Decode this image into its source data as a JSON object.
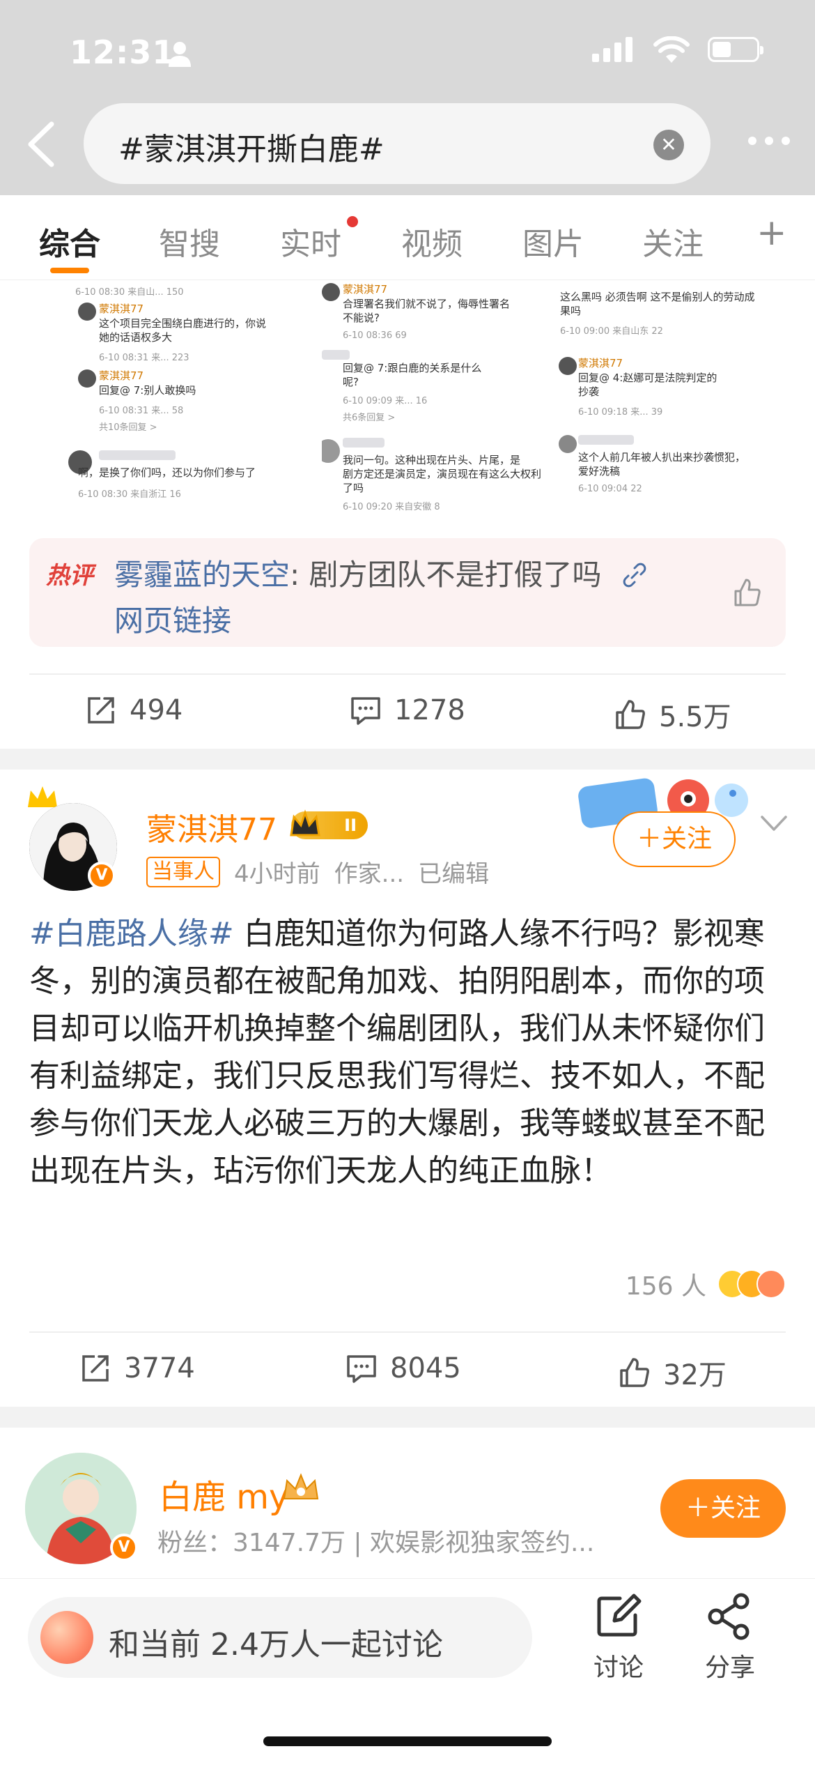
{
  "status_bar": {
    "time": "12:31"
  },
  "search": {
    "query": "#蒙淇淇开撕白鹿#"
  },
  "tabs": [
    {
      "label": "综合"
    },
    {
      "label": "智搜"
    },
    {
      "label": "实时"
    },
    {
      "label": "视频"
    },
    {
      "label": "图片"
    },
    {
      "label": "关注"
    }
  ],
  "tabs_plus": "+",
  "screenshots": {
    "col1": [
      "6-10 08:30  来自山...        150",
      "蒙淇淇77",
      "这个项目完全围绕白鹿进行的，你说",
      "她的话语权多大",
      "6-10 08:31  来...              223",
      "蒙淇淇77",
      "回复@       7:别人敢换吗",
      "6-10 08:31  来...               58",
      "共10条回复 >",
      "啊，是换了你们吗，还以为你们参与了",
      "6-10 08:30  来自浙江            16"
    ],
    "col2": [
      "蒙淇淇77",
      "合理署名我们就不说了，侮辱性署名",
      "不能说?",
      "6-10 08:36                        69",
      "回复@         7:跟白鹿的关系是什么",
      "呢?",
      "6-10 09:09  来...              16",
      "共6条回复 >",
      "我问一句。这种出现在片头、片尾，是",
      "剧方定还是演员定，演员现在有这么大权利",
      "了吗",
      "6-10 09:20  来自安徽             8"
    ],
    "col3": [
      "这么黑吗 必须告啊 这不是偷别人的劳动成",
      "果吗",
      "6-10 09:00  来自山东            22",
      "蒙淇淇77",
      "回复@        4:赵娜可是法院判定的",
      "抄袭",
      "6-10 09:18  来...              39",
      "这个人前几年被人扒出来抄袭惯犯，",
      "爱好洗稿",
      "6-10 09:04                        22"
    ]
  },
  "hot_comment": {
    "badge": "热评",
    "user": "雾霾蓝的天空",
    "text": ": 剧方团队不是打假了吗",
    "link_label": "网页链接"
  },
  "post1_actions": {
    "shares": "494",
    "comments": "1278",
    "likes": "5.5万"
  },
  "post2": {
    "username": "蒙淇淇77",
    "level": "II",
    "role_tag": "当事人",
    "time": "4小时前",
    "source": "作家...",
    "edited": "已编辑",
    "follow_label": "＋关注",
    "hashtag": "#白鹿路人缘#",
    "body": " 白鹿知道你为何路人缘不行吗？影视寒冬，别的演员都在被配角加戏、拍阴阳剧本，而你的项目却可以临开机换掉整个编剧团队，我们从未怀疑你们有利益绑定，我们只反思我们写得烂、技不如人，不配参与你们天龙人必破三万的大爆剧，我等蝼蚁甚至不配出现在片头，玷污你们天龙人的纯正血脉！",
    "reaction_count": "156 人",
    "actions": {
      "shares": "3774",
      "comments": "8045",
      "likes": "32万"
    }
  },
  "post3": {
    "username": "白鹿 my",
    "fans": "粉丝：3147.7万 | 欢娱影视独家签约...",
    "follow_label": "＋关注"
  },
  "bottom_bar": {
    "discuss_text": "和当前 2.4万人一起讨论",
    "discuss_label": "讨论",
    "share_label": "分享"
  },
  "colors": {
    "accent": "#ff8200",
    "link": "#4a6fa5",
    "hot_bg": "#fcf2f2"
  }
}
